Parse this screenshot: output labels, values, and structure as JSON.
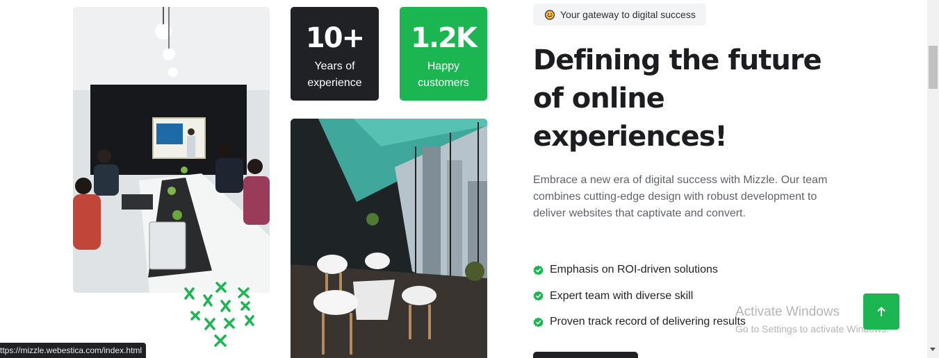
{
  "stats": [
    {
      "value": "10+",
      "label": "Years of experience"
    },
    {
      "value": "1.2K",
      "label": "Happy customers"
    }
  ],
  "hero": {
    "badge": "Your gateway to digital success",
    "headline": "Defining the future of online experiences!",
    "lead": "Embrace a new era of digital success with Mizzle. Our team combines cutting-edge design with robust development to deliver websites that captivate and convert.",
    "features": [
      "Emphasis on ROI-driven solutions",
      "Expert team with diverse skill",
      "Proven track record of delivering results"
    ]
  },
  "windows_watermark": {
    "title": "Activate Windows",
    "subtitle": "Go to Settings to activate Windows."
  },
  "status_bar": {
    "url": "ttps://mizzle.webestica.com/index.html"
  },
  "colors": {
    "accent": "#1bb651",
    "dark": "#1f2125",
    "text": "#1c1d21",
    "muted": "#5f6368"
  },
  "icons": {
    "badge": "smiley-heart-icon",
    "feature": "check-circle-icon",
    "scroll_top": "arrow-up-icon"
  }
}
